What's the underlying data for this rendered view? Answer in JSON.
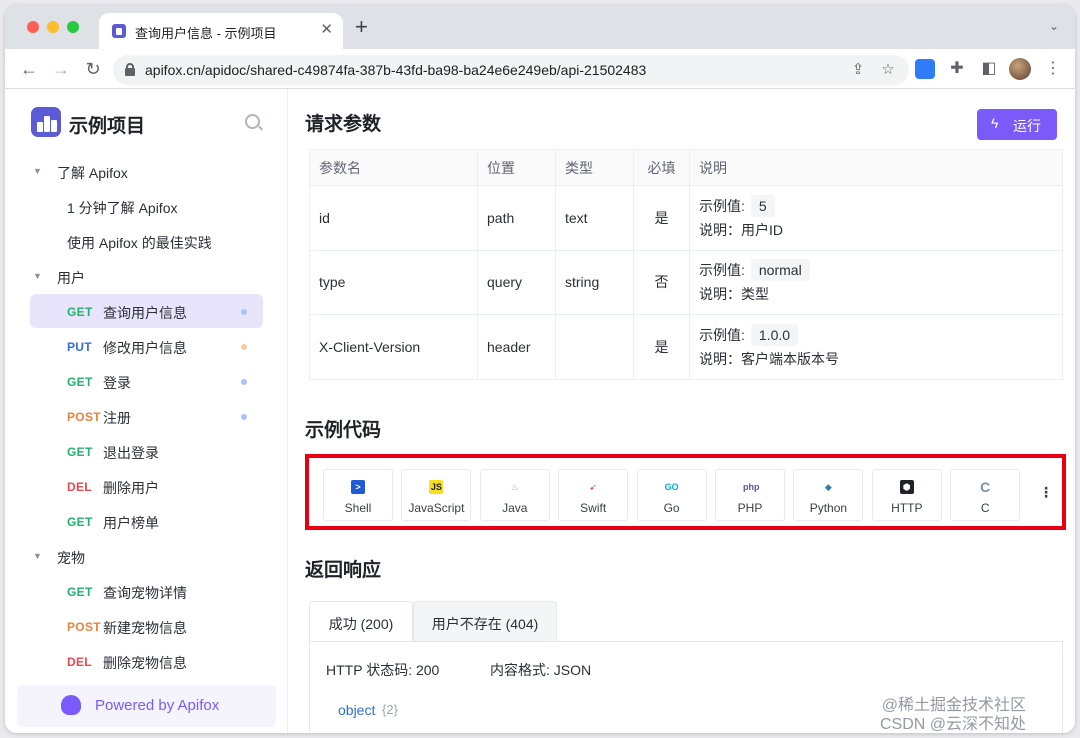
{
  "browser": {
    "tab_title": "查询用户信息 - 示例项目",
    "url": "apifox.cn/apidoc/shared-c49874fa-387b-43fd-ba98-ba24e6e249eb/api-21502483"
  },
  "sidebar": {
    "project_title": "示例项目",
    "tree": [
      {
        "kind": "folder",
        "label": "了解 Apifox"
      },
      {
        "kind": "doc",
        "label": "1 分钟了解 Apifox"
      },
      {
        "kind": "doc",
        "label": "使用 Apifox 的最佳实践"
      },
      {
        "kind": "folder",
        "label": "用户"
      },
      {
        "kind": "api",
        "method": "GET",
        "label": "查询用户信息",
        "active": true,
        "dot_color": "#a9c4f5"
      },
      {
        "kind": "api",
        "method": "PUT",
        "label": "修改用户信息",
        "dot_color": "#f7c9a4"
      },
      {
        "kind": "api",
        "method": "GET",
        "label": "登录",
        "dot_color": "#a9c4f5"
      },
      {
        "kind": "api",
        "method": "POST",
        "label": "注册",
        "dot_color": "#a9c4f5"
      },
      {
        "kind": "api",
        "method": "GET",
        "label": "退出登录"
      },
      {
        "kind": "api",
        "method": "DEL",
        "label": "删除用户"
      },
      {
        "kind": "api",
        "method": "GET",
        "label": "用户榜单"
      },
      {
        "kind": "folder",
        "label": "宠物"
      },
      {
        "kind": "api",
        "method": "GET",
        "label": "查询宠物详情"
      },
      {
        "kind": "api",
        "method": "POST",
        "label": "新建宠物信息"
      },
      {
        "kind": "api",
        "method": "DEL",
        "label": "删除宠物信息"
      }
    ],
    "powered_by": "Powered by Apifox"
  },
  "method_colors": {
    "GET": "#21b26b",
    "PUT": "#2f6fd8",
    "POST": "#e8843a",
    "DEL": "#e5484d"
  },
  "main": {
    "request_params_title": "请求参数",
    "run_button": "运行",
    "params_table": {
      "headers": [
        "参数名",
        "位置",
        "类型",
        "必填",
        "说明"
      ],
      "example_label": "示例值:",
      "rows": [
        {
          "name": "id",
          "location": "path",
          "type": "text",
          "required": "是",
          "example": "5",
          "desc": "说明：用户ID"
        },
        {
          "name": "type",
          "location": "query",
          "type": "string",
          "required": "否",
          "example": "normal",
          "desc": "说明：类型"
        },
        {
          "name": "X-Client-Version",
          "location": "header",
          "type": "",
          "required": "是",
          "example": "1.0.0",
          "desc": "说明：客户端本版本号"
        }
      ]
    },
    "sample_code_title": "示例代码",
    "code_tabs": [
      {
        "label": "Shell",
        "icon": "shell-icon",
        "color": "#1f5bd6",
        "glyph": ">"
      },
      {
        "label": "JavaScript",
        "icon": "javascript-icon",
        "color": "#f7df1e",
        "glyph": "JS"
      },
      {
        "label": "Java",
        "icon": "java-icon",
        "color": "#9aa7b4",
        "glyph": "♨"
      },
      {
        "label": "Swift",
        "icon": "swift-icon",
        "color": "#f05138",
        "glyph": "➹"
      },
      {
        "label": "Go",
        "icon": "go-icon",
        "color": "#00add8",
        "glyph": "GO"
      },
      {
        "label": "PHP",
        "icon": "php-icon",
        "color": "#4f5b93",
        "glyph": "php"
      },
      {
        "label": "Python",
        "icon": "python-icon",
        "color": "#3776ab",
        "glyph": "◆"
      },
      {
        "label": "HTTP",
        "icon": "http-icon",
        "color": "#1f2328",
        "glyph": "⬢"
      },
      {
        "label": "C",
        "icon": "c-icon",
        "color": "#7f8fa6",
        "glyph": "C"
      }
    ],
    "code_more": "⋮",
    "response_title": "返回响应",
    "response_tabs": [
      {
        "label": "成功 (200)",
        "active": true
      },
      {
        "label": "用户不存在 (404)",
        "active": false
      }
    ],
    "status_code": "HTTP 状态码: 200",
    "content_type": "内容格式: JSON",
    "object_type": "object",
    "object_count": "{2}"
  },
  "watermark": {
    "line1": "@稀土掘金技术社区",
    "line2": "CSDN @云深不知处"
  }
}
